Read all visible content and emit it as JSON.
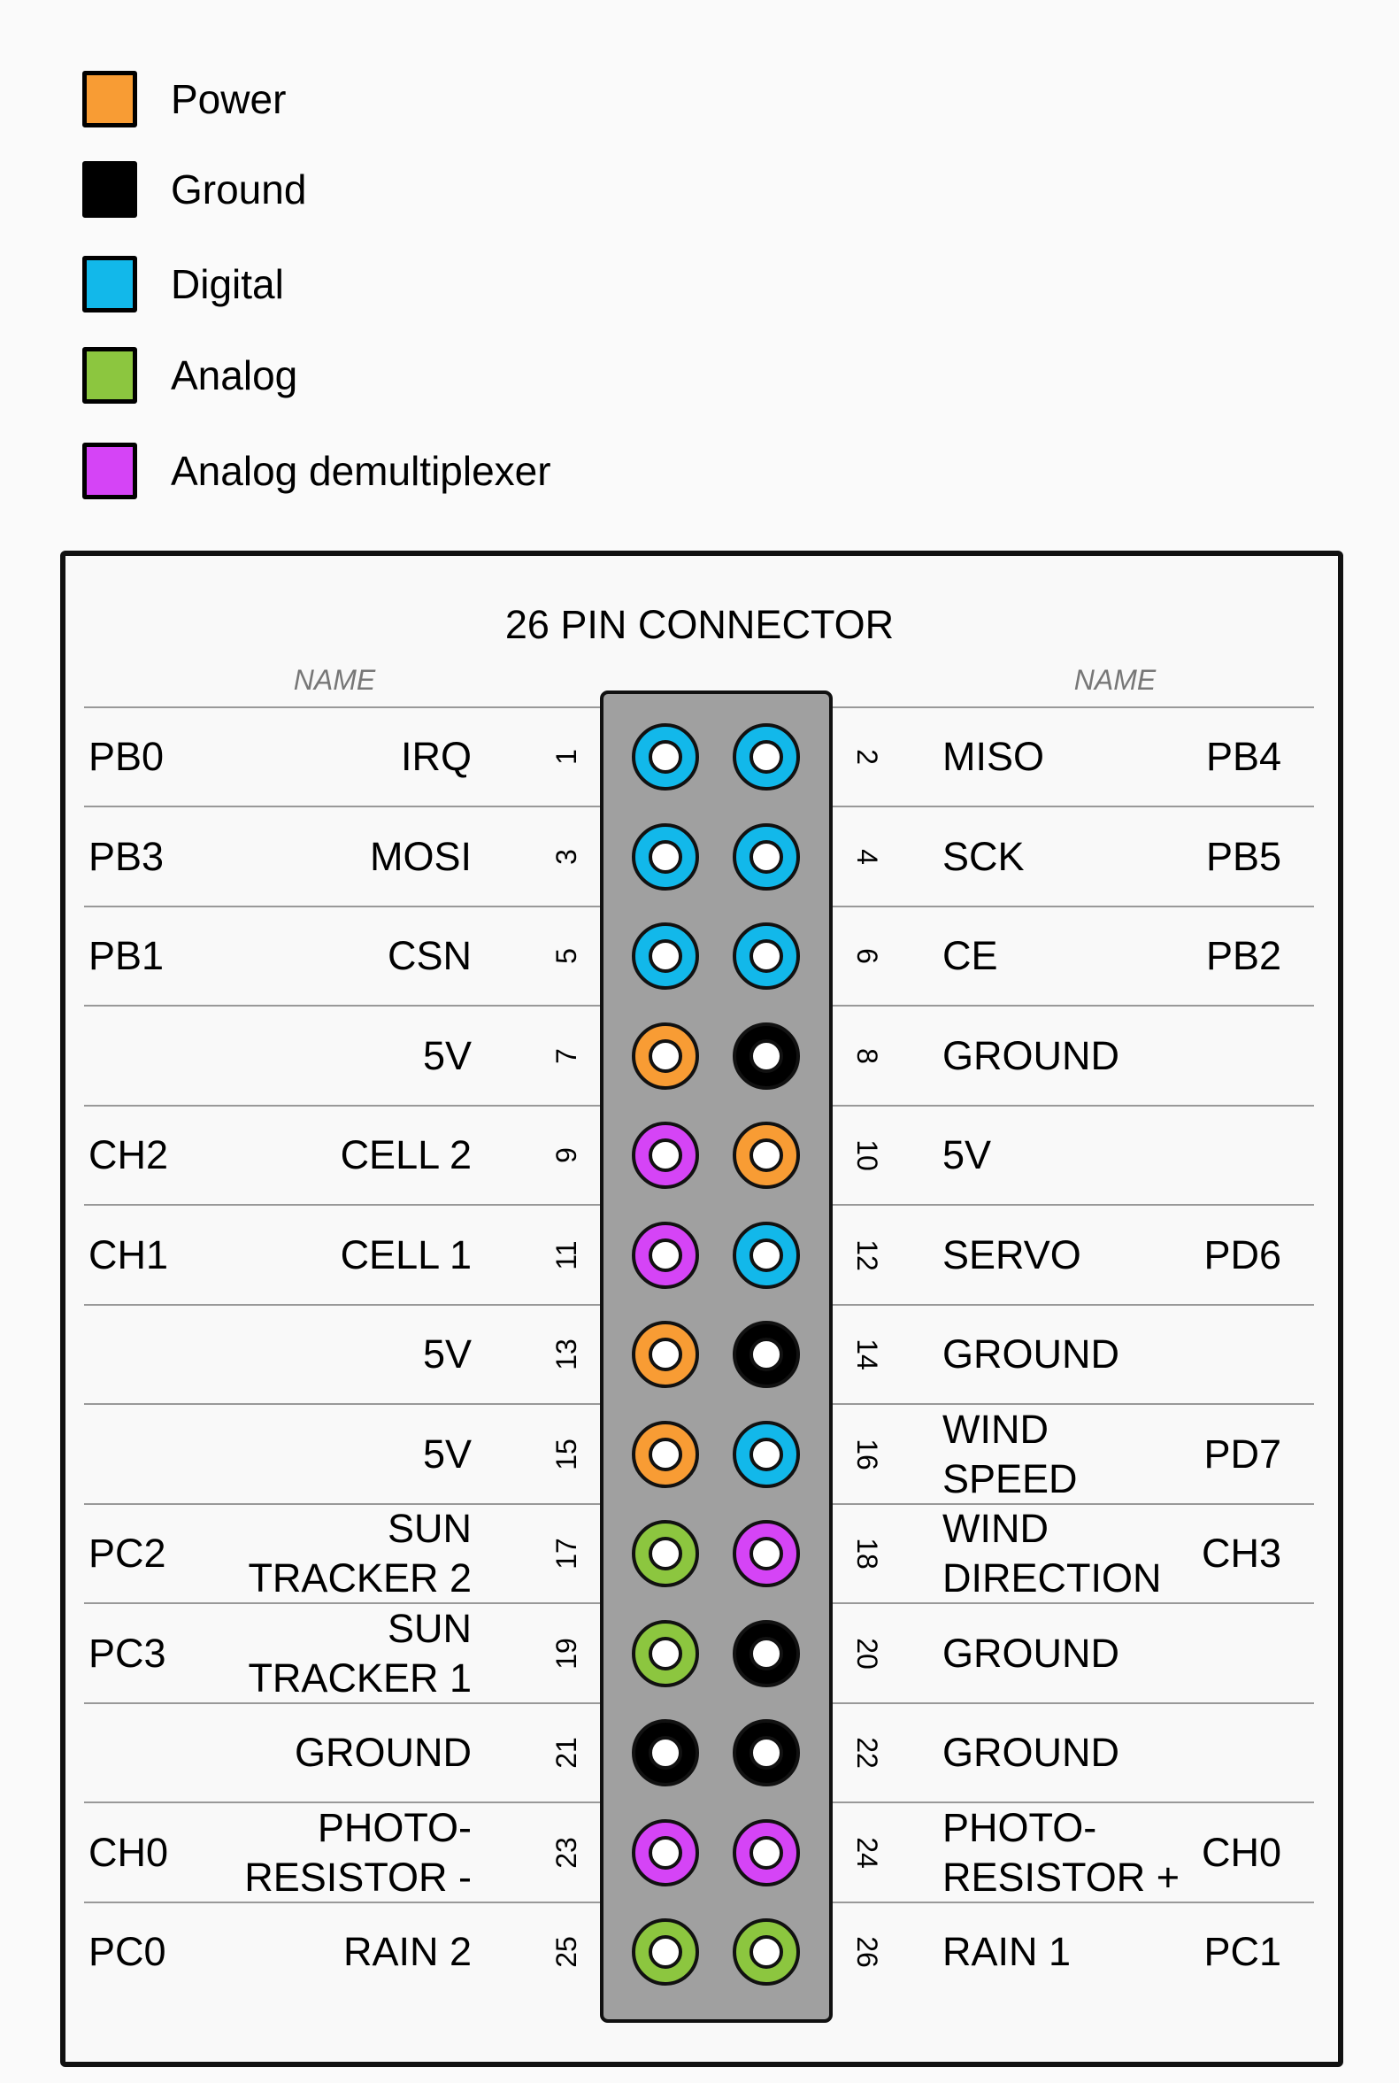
{
  "colors": {
    "power": "#f89c34",
    "ground": "#000000",
    "digital": "#12b8ea",
    "analog": "#8cc63f",
    "demux": "#d544f6"
  },
  "legend": [
    {
      "type": "power",
      "label": "Power"
    },
    {
      "type": "ground",
      "label": "Ground"
    },
    {
      "type": "digital",
      "label": "Digital"
    },
    {
      "type": "analog",
      "label": "Analog"
    },
    {
      "type": "demux",
      "label": "Analog demultiplexer"
    }
  ],
  "title": "26 PIN CONNECTOR",
  "column_headers": {
    "left": "NAME",
    "right": "NAME"
  },
  "rows": [
    {
      "left": {
        "pin": "1",
        "name": "IRQ",
        "code": "PB0",
        "type": "digital"
      },
      "right": {
        "pin": "2",
        "name": "MISO",
        "code": "PB4",
        "type": "digital"
      }
    },
    {
      "left": {
        "pin": "3",
        "name": "MOSI",
        "code": "PB3",
        "type": "digital"
      },
      "right": {
        "pin": "4",
        "name": "SCK",
        "code": "PB5",
        "type": "digital"
      }
    },
    {
      "left": {
        "pin": "5",
        "name": "CSN",
        "code": "PB1",
        "type": "digital"
      },
      "right": {
        "pin": "6",
        "name": "CE",
        "code": "PB2",
        "type": "digital"
      }
    },
    {
      "left": {
        "pin": "7",
        "name": "5V",
        "code": "",
        "type": "power"
      },
      "right": {
        "pin": "8",
        "name": "GROUND",
        "code": "",
        "type": "ground"
      }
    },
    {
      "left": {
        "pin": "9",
        "name": "CELL 2",
        "code": "CH2",
        "type": "demux"
      },
      "right": {
        "pin": "10",
        "name": "5V",
        "code": "",
        "type": "power"
      }
    },
    {
      "left": {
        "pin": "11",
        "name": "CELL 1",
        "code": "CH1",
        "type": "demux"
      },
      "right": {
        "pin": "12",
        "name": "SERVO",
        "code": "PD6",
        "type": "digital"
      }
    },
    {
      "left": {
        "pin": "13",
        "name": "5V",
        "code": "",
        "type": "power"
      },
      "right": {
        "pin": "14",
        "name": "GROUND",
        "code": "",
        "type": "ground"
      }
    },
    {
      "left": {
        "pin": "15",
        "name": "5V",
        "code": "",
        "type": "power"
      },
      "right": {
        "pin": "16",
        "name": "WIND\nSPEED",
        "code": "PD7",
        "type": "digital"
      }
    },
    {
      "left": {
        "pin": "17",
        "name": "SUN\nTRACKER 2",
        "code": "PC2",
        "type": "analog"
      },
      "right": {
        "pin": "18",
        "name": "WIND\nDIRECTION",
        "code": "CH3",
        "type": "demux"
      }
    },
    {
      "left": {
        "pin": "19",
        "name": "SUN\nTRACKER 1",
        "code": "PC3",
        "type": "analog"
      },
      "right": {
        "pin": "20",
        "name": "GROUND",
        "code": "",
        "type": "ground"
      }
    },
    {
      "left": {
        "pin": "21",
        "name": "GROUND",
        "code": "",
        "type": "ground"
      },
      "right": {
        "pin": "22",
        "name": "GROUND",
        "code": "",
        "type": "ground"
      }
    },
    {
      "left": {
        "pin": "23",
        "name": "PHOTO-\nRESISTOR -",
        "code": "CH0",
        "type": "demux"
      },
      "right": {
        "pin": "24",
        "name": "PHOTO-\nRESISTOR +",
        "code": "CH0",
        "type": "demux"
      }
    },
    {
      "left": {
        "pin": "25",
        "name": "RAIN 2",
        "code": "PC0",
        "type": "analog"
      },
      "right": {
        "pin": "26",
        "name": "RAIN 1",
        "code": "PC1",
        "type": "analog"
      }
    }
  ]
}
